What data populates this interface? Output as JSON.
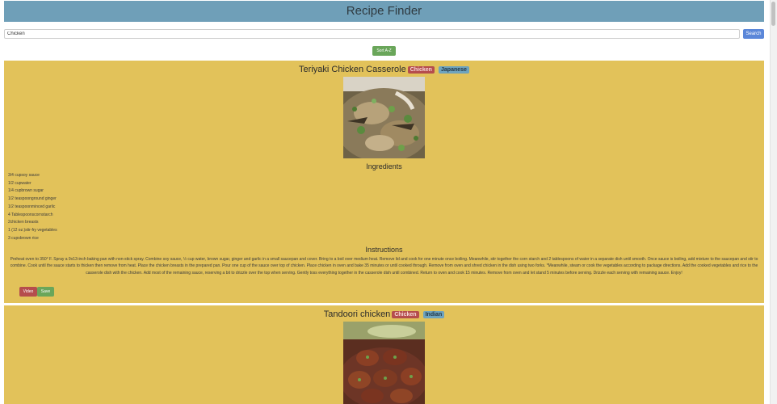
{
  "header": {
    "title": "Recipe Finder"
  },
  "search": {
    "value": "Chicken",
    "button_label": "Search"
  },
  "sort": {
    "label": "Sort A-Z"
  },
  "recipes": [
    {
      "title": "Teriyaki Chicken Casserole",
      "tags": [
        "Chicken",
        "Japanese"
      ],
      "ingredients_heading": "Ingredients",
      "ingredients": [
        "3/4 cupsoy sauce",
        "1/2 cupwater",
        "1/4 cupbrown sugar",
        "1/2 teaspoonground ginger",
        "1/2 teaspoonminced garlic",
        "4 Tablespoonscornstarch",
        "2chicken breasts",
        "1 (12 oz.)stir-fry vegetables",
        "3 cupsbrown rice"
      ],
      "instructions_heading": "Instructions",
      "instructions": "Preheat oven to 350° F. Spray a 9x13-inch baking pan with non-stick spray. Combine soy sauce, ½ cup water, brown sugar, ginger and garlic in a small saucepan and cover. Bring to a boil over medium heat. Remove lid and cook for one minute once boiling. Meanwhile, stir together the corn starch and 2 tablespoons of water in a separate dish until smooth. Once sauce is boiling, add mixture to the saucepan and stir to combine. Cook until the sauce starts to thicken then remove from heat. Place the chicken breasts in the prepared pan. Pour one cup of the sauce over top of chicken. Place chicken in oven and bake 35 minutes or until cooked through. Remove from oven and shred chicken in the dish using two forks. *Meanwhile, steam or cook the vegetables according to package directions. Add the cooked vegetables and rice to the casserole dish with the chicken. Add most of the remaining sauce, reserving a bit to drizzle over the top when serving. Gently toss everything together in the casserole dish until combined. Return to oven and cook 15 minutes. Remove from oven and let stand 5 minutes before serving. Drizzle each serving with remaining sauce. Enjoy!",
      "video_label": "Video",
      "save_label": "Save"
    },
    {
      "title": "Tandoori chicken",
      "tags": [
        "Chicken",
        "Indian"
      ]
    }
  ]
}
